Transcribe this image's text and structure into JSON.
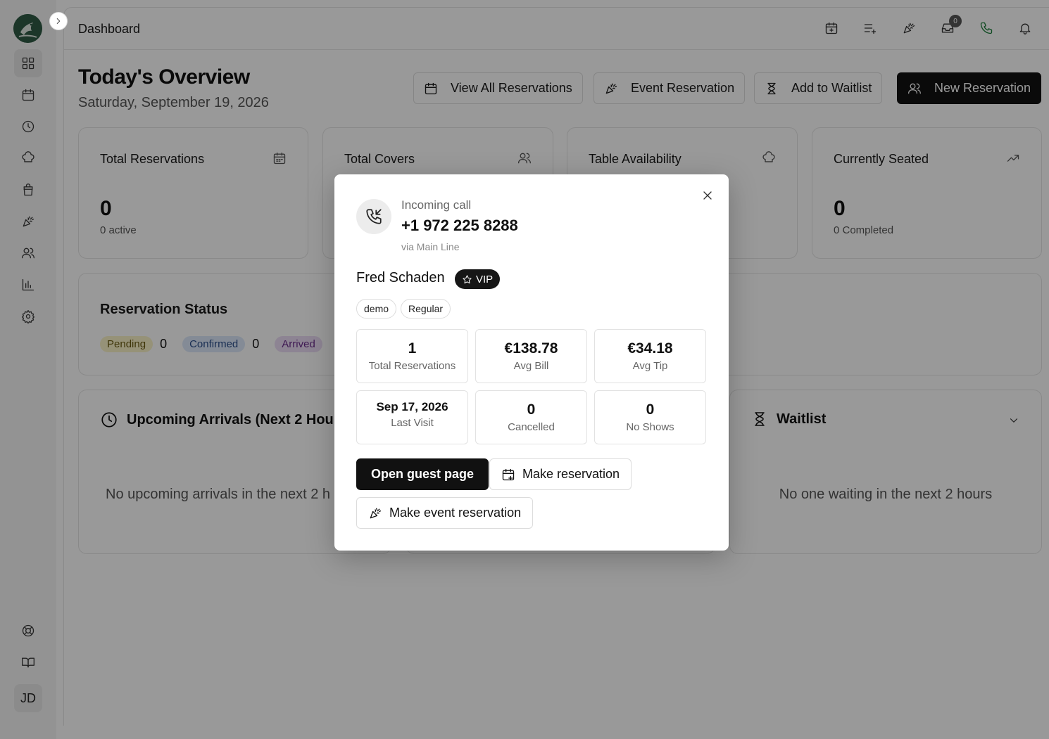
{
  "topbar": {
    "title": "Dashboard",
    "inbox_count": "0"
  },
  "user": {
    "initials": "JD"
  },
  "page": {
    "title": "Today's Overview",
    "date": "Saturday, September 19, 2026"
  },
  "actions": {
    "view_all": "View All Reservations",
    "event": "Event Reservation",
    "waitlist": "Add to Waitlist",
    "new": "New Reservation"
  },
  "stats": [
    {
      "title": "Total Reservations",
      "value": "0",
      "sub": "0 active",
      "icon": "calendar-icon"
    },
    {
      "title": "Total Covers",
      "value": "",
      "sub": "",
      "icon": "users-icon"
    },
    {
      "title": "Table Availability",
      "value": "",
      "sub": "",
      "icon": "chef-hat-icon"
    },
    {
      "title": "Currently Seated",
      "value": "0",
      "sub": "0 Completed",
      "icon": "trending-up-icon"
    }
  ],
  "status": {
    "title": "Reservation Status",
    "items": [
      {
        "label": "Pending",
        "count": "0"
      },
      {
        "label": "Confirmed",
        "count": "0"
      },
      {
        "label": "Arrived",
        "count": ""
      }
    ]
  },
  "upcoming": {
    "title": "Upcoming Arrivals (Next 2 Hours",
    "empty": "No upcoming arrivals in the next 2 h"
  },
  "waitlist": {
    "title": "Waitlist",
    "empty": "No one waiting in the next 2 hours"
  },
  "modal": {
    "call_label": "Incoming call",
    "phone": "+1 972 225 8288",
    "line": "via Main Line",
    "guest_name": "Fred Schaden",
    "vip": "VIP",
    "tags": [
      "demo",
      "Regular"
    ],
    "stats": [
      {
        "value": "1",
        "label": "Total Reservations"
      },
      {
        "value": "€138.78",
        "label": "Avg Bill"
      },
      {
        "value": "€34.18",
        "label": "Avg Tip"
      },
      {
        "value": "Sep 17, 2026",
        "label": "Last Visit"
      },
      {
        "value": "0",
        "label": "Cancelled"
      },
      {
        "value": "0",
        "label": "No Shows"
      }
    ],
    "btn_guest": "Open guest page",
    "btn_reservation": "Make reservation",
    "btn_event": "Make event reservation"
  }
}
